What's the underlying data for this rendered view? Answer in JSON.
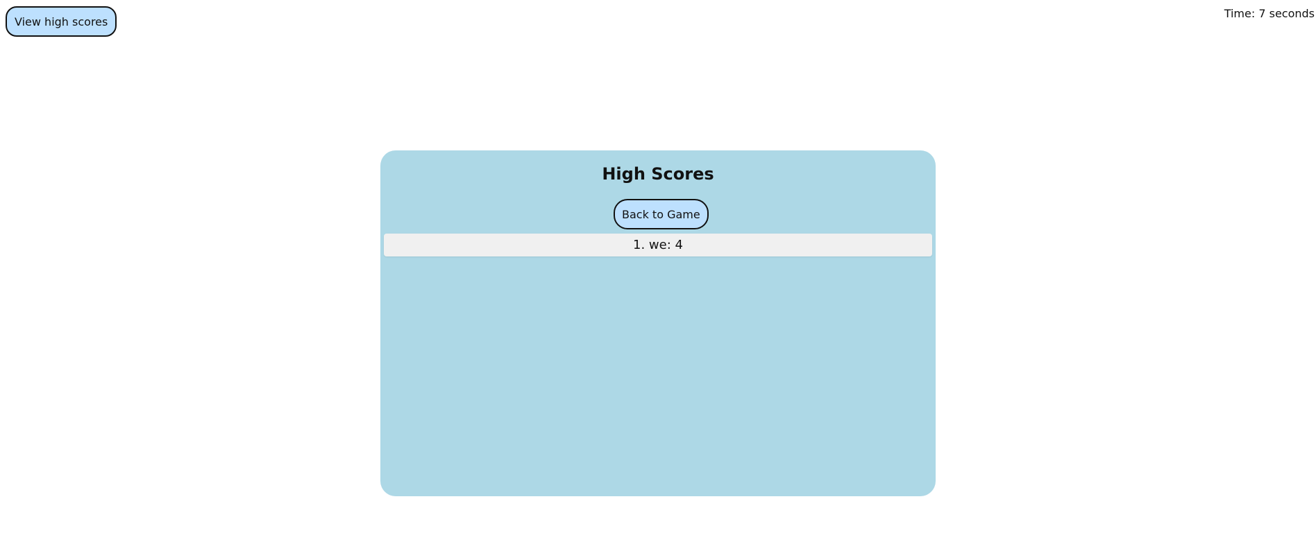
{
  "header": {
    "view_high_scores_label": "View high scores",
    "timer_text": "Time: 7 seconds"
  },
  "panel": {
    "title": "High Scores",
    "back_label": "Back to Game",
    "scores": [
      "1. we: 4"
    ]
  },
  "colors": {
    "button_bg": "#bde0fe",
    "panel_bg": "#add8e6",
    "score_bg": "#f0f0f0"
  }
}
